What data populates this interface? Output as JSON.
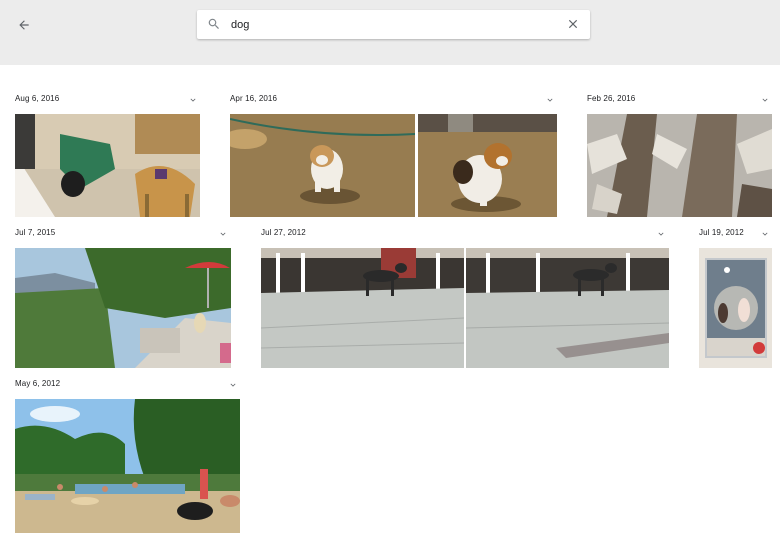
{
  "search": {
    "query": "dog"
  },
  "icons": {
    "back": "arrow-back-icon",
    "search": "search-icon",
    "clear": "close-icon",
    "expand": "chevron-down-icon"
  },
  "groups": [
    {
      "date": "Aug 6, 2016",
      "photo_count": 1
    },
    {
      "date": "Apr 16, 2016",
      "photo_count": 2
    },
    {
      "date": "Feb 26, 2016",
      "photo_count": 1
    },
    {
      "date": "Jul 7, 2015",
      "photo_count": 1
    },
    {
      "date": "Jul 27, 2012",
      "photo_count": 2
    },
    {
      "date": "Jul 19, 2012",
      "photo_count": 1
    },
    {
      "date": "May 6, 2012",
      "photo_count": 1
    }
  ]
}
